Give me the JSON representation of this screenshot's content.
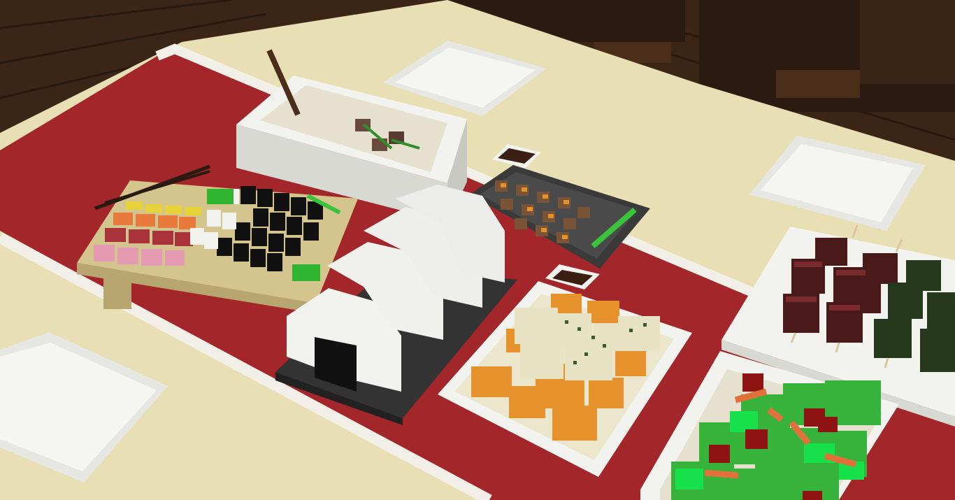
{
  "scene": {
    "kind": "voxel-game-3d-view",
    "description_tags": [
      "table",
      "table-runner",
      "plates",
      "sushi-board",
      "rice-bowl",
      "onigiri-tray",
      "tofu-dish",
      "yakitori-tray",
      "skewers-plate",
      "salad-bowl",
      "soy-sauce-dishes"
    ],
    "colors": {
      "floor_dark": "#3b2516",
      "floor_plank": "#5a3a22",
      "chair_dark": "#2b1a10",
      "table_top": "#e9dfb4",
      "runner_red": "#a3262b",
      "runner_stripe": "#f1efe8",
      "plate_white": "#f2f2ee",
      "wood_board": "#d4c48e",
      "tray_dark": "#3a3a3a",
      "rice": "#e6e1cf",
      "tofu": "#e8e2c4",
      "fried_tofu": "#e5922d",
      "soy": "#3a1f12",
      "salad_green": "#37b23b",
      "tomato": "#8e1313",
      "nori": "#111111",
      "salmon": "#e87a3c",
      "tuna": "#a8333a"
    }
  }
}
